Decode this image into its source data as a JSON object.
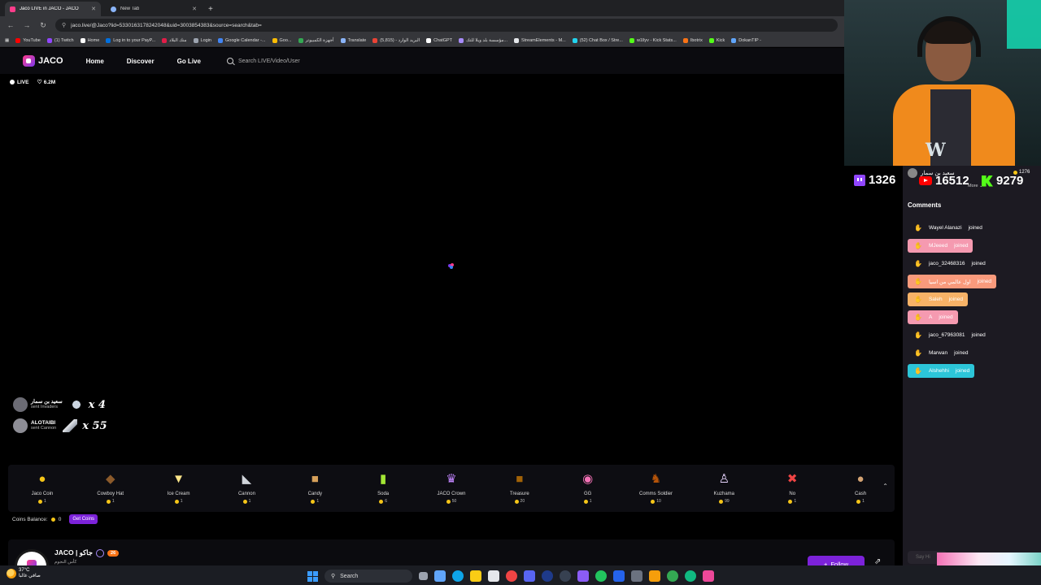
{
  "browser": {
    "tabs": [
      {
        "title": "Jaco LIVE in JACO - JACO",
        "active": true,
        "color": "#ff3d8b"
      },
      {
        "title": "New Tab",
        "active": false,
        "color": "#8ab4f8"
      }
    ],
    "new_tab_symbol": "+",
    "url": "jaco.live/@Jaco?lid=5330163178242048&uid=3003854383&source=search&tab=",
    "bookmarks": [
      {
        "label": "YouTube",
        "color": "#ff0000"
      },
      {
        "label": "(1) Twitch",
        "color": "#9146ff"
      },
      {
        "label": "Home",
        "color": "#ffffff"
      },
      {
        "label": "Log in to your PayP...",
        "color": "#0070e0"
      },
      {
        "label": "منك البلاد",
        "color": "#e11d48"
      },
      {
        "label": "Login",
        "color": "#9ca3af"
      },
      {
        "label": "Google Calendar -...",
        "color": "#4285f4"
      },
      {
        "label": "Goo...",
        "color": "#fbbc04"
      },
      {
        "label": "أجهزة الكمبيوتر",
        "color": "#34a853"
      },
      {
        "label": "Translate",
        "color": "#8ab4f8"
      },
      {
        "label": "البريد الوارد - (5,815)",
        "color": "#ea4335"
      },
      {
        "label": "ChatGPT",
        "color": "#ffffff"
      },
      {
        "label": "مؤسسة بلد ويلا للتك...",
        "color": "#a78bfa"
      },
      {
        "label": "StreamElements - M...",
        "color": "#e5e7eb"
      },
      {
        "label": "(52) Chat Box / Stre...",
        "color": "#22d3ee"
      },
      {
        "label": "w1llyv - Kick Stats...",
        "color": "#53fc18"
      },
      {
        "label": "Ibotrix",
        "color": "#f97316"
      },
      {
        "label": "Kick",
        "color": "#53fc18"
      },
      {
        "label": "DokanTIP -",
        "color": "#60a5fa"
      }
    ]
  },
  "site": {
    "logo_text": "JACO",
    "nav": [
      "Home",
      "Discover",
      "Go Live"
    ],
    "search_placeholder": "Search LIVE/Video/User",
    "live_label": "LIVE",
    "likes": "6.2M"
  },
  "gift_notifications": [
    {
      "name": "سعيد بن سمار",
      "action": "sent Invaders",
      "count": "x 4"
    },
    {
      "name": "ALOTAIBI",
      "action": "sent Cannon",
      "count": "x 55"
    }
  ],
  "gifts": [
    {
      "name": "Jaco Coin",
      "price": "1",
      "icon": "coin-icon",
      "glyph": "●",
      "color": "#f5c518"
    },
    {
      "name": "Cowboy Hat",
      "price": "1",
      "icon": "cowboy-hat-icon",
      "glyph": "◆",
      "color": "#8b5a2b"
    },
    {
      "name": "Ice Cream",
      "price": "1",
      "icon": "ice-cream-icon",
      "glyph": "▼",
      "color": "#fde68a"
    },
    {
      "name": "Cannon",
      "price": "1",
      "icon": "cannon-icon",
      "glyph": "◣",
      "color": "#d1d5db"
    },
    {
      "name": "Candy",
      "price": "1",
      "icon": "candy-icon",
      "glyph": "■",
      "color": "#d6a05a"
    },
    {
      "name": "Soda",
      "price": "6",
      "icon": "soda-icon",
      "glyph": "▮",
      "color": "#a3e635"
    },
    {
      "name": "JACO Crown",
      "price": "50",
      "icon": "crown-icon",
      "glyph": "♛",
      "color": "#c084fc"
    },
    {
      "name": "Treasure",
      "price": "20",
      "icon": "treasure-icon",
      "glyph": "■",
      "color": "#a16207"
    },
    {
      "name": "GG",
      "price": "1",
      "icon": "gg-icon",
      "glyph": "◉",
      "color": "#f472b6"
    },
    {
      "name": "Comms Soldier",
      "price": "10",
      "icon": "soldier-icon",
      "glyph": "♞",
      "color": "#b45309"
    },
    {
      "name": "Kuzhama",
      "price": "99",
      "icon": "kuzhama-icon",
      "glyph": "♙",
      "color": "#e9d5ff"
    },
    {
      "name": "No",
      "price": "1",
      "icon": "no-icon",
      "glyph": "✖",
      "color": "#ef4444"
    },
    {
      "name": "Cash",
      "price": "1",
      "icon": "cash-bag-icon",
      "glyph": "●",
      "color": "#d4a373"
    }
  ],
  "gift_chevron": "⌃",
  "balance": {
    "label": "Coins Balance:",
    "value": "0",
    "button": "Get Coins"
  },
  "streamer": {
    "name": "JACO | جاكو",
    "level": "26",
    "subtitle": "كأس النجوم",
    "follow": "Follow",
    "follow_plus": "+"
  },
  "stats": {
    "twitch": "1326",
    "youtube": "16512",
    "kick": "9279",
    "top_viewer": "سعيد بن سمار",
    "coins": "1276",
    "more": "More ⌄"
  },
  "comments": {
    "title": "Comments",
    "items": [
      {
        "user": "Wayel Alanazi",
        "text": "joined",
        "bg": "transparent"
      },
      {
        "user": "MJeeed",
        "text": "joined",
        "bg": "#f59ab0"
      },
      {
        "user": "jaco_32468316",
        "text": "joined",
        "bg": "transparent"
      },
      {
        "user": "اول عالمي من اسيا",
        "text": "joined",
        "bg": "#f99a7c"
      },
      {
        "user": "Saleh",
        "text": "joined",
        "bg": "#f7b267"
      },
      {
        "user": "A",
        "text": "joined",
        "bg": "#f59ab0"
      },
      {
        "user": "jaco_67963081",
        "text": "joined",
        "bg": "transparent"
      },
      {
        "user": "Marwan",
        "text": "joined",
        "bg": "transparent"
      },
      {
        "user": "Alshehhi",
        "text": "joined",
        "bg": "#2cc5d8"
      }
    ],
    "say_hi": "Say Hi"
  },
  "taskbar": {
    "temp": "37°C",
    "weather_desc": "صافي غالبا",
    "search": "Search"
  }
}
